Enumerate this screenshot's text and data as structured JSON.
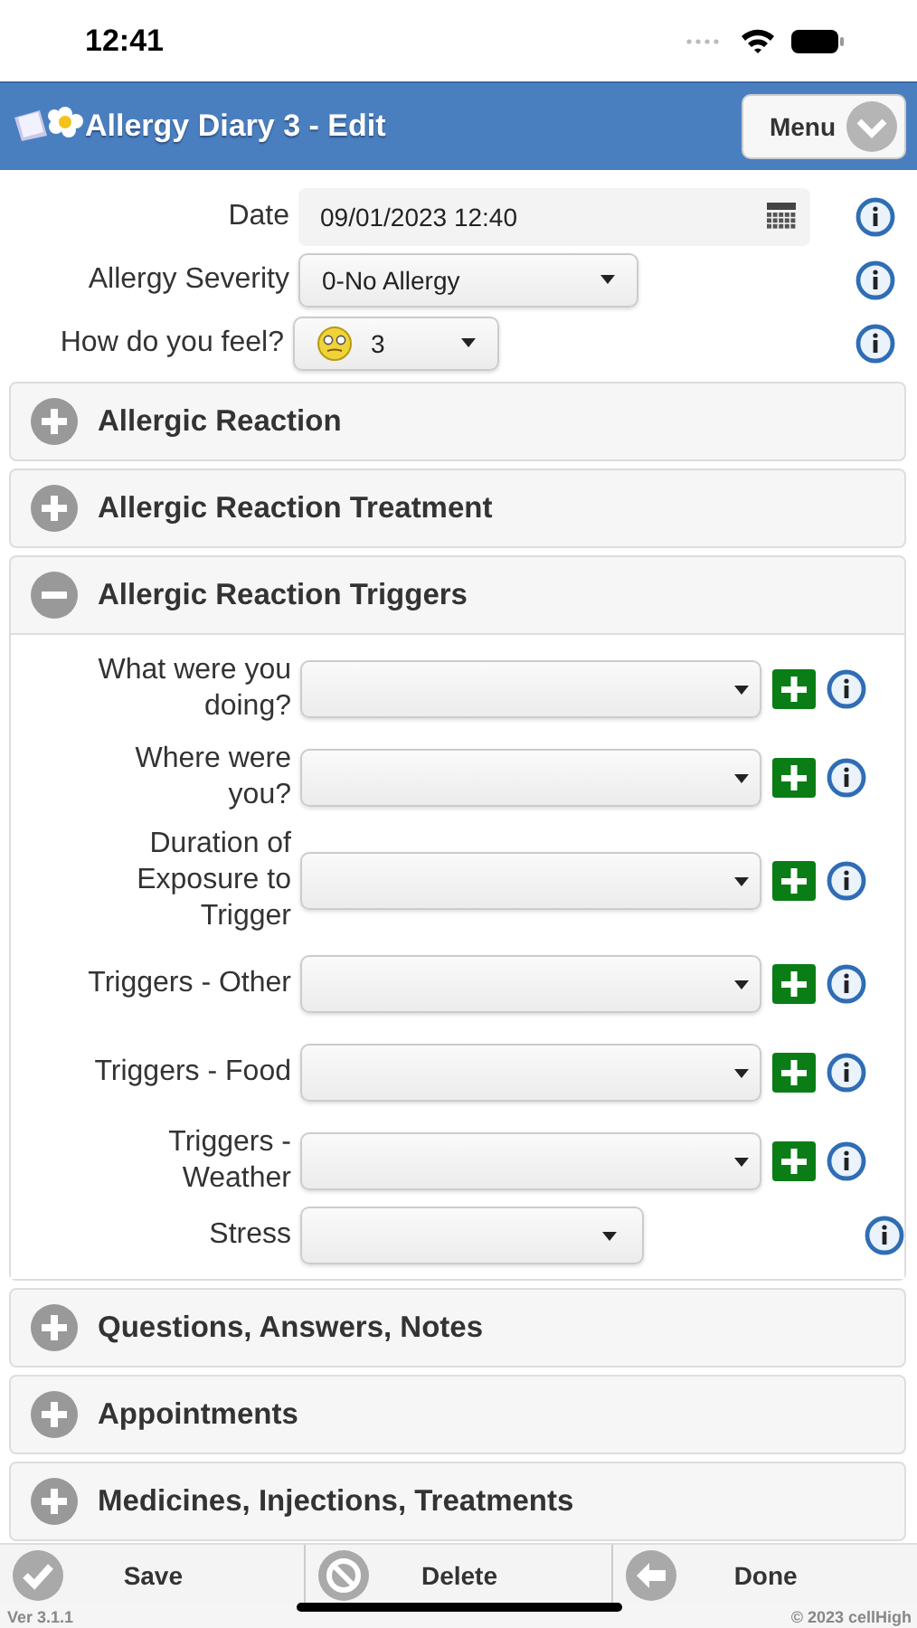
{
  "status_bar": {
    "time": "12:41"
  },
  "header": {
    "title": "Allergy Diary 3 - Edit",
    "menu_button": "Menu"
  },
  "top_fields": [
    {
      "label": "Date",
      "value": "09/01/2023 12:40",
      "kind": "date"
    },
    {
      "label": "Allergy Severity",
      "value": "0-No Allergy",
      "kind": "select"
    },
    {
      "label": "How do you feel?",
      "value": "3",
      "kind": "mood"
    }
  ],
  "sections": [
    {
      "title": "Allergic Reaction",
      "expanded": false
    },
    {
      "title": "Allergic Reaction Treatment",
      "expanded": false
    },
    {
      "title": "Allergic Reaction Triggers",
      "expanded": true,
      "fields": [
        {
          "label": "What were you doing?",
          "kind": "add"
        },
        {
          "label": "Where were you?",
          "kind": "add"
        },
        {
          "label": "Duration of Exposure to Trigger",
          "kind": "add"
        },
        {
          "label": "Triggers - Other",
          "kind": "add"
        },
        {
          "label": "Triggers - Food",
          "kind": "add"
        },
        {
          "label": "Triggers - Weather",
          "kind": "add"
        },
        {
          "label": "Stress",
          "kind": "plain"
        }
      ]
    },
    {
      "title": "Questions, Answers, Notes",
      "expanded": false
    },
    {
      "title": "Appointments",
      "expanded": false
    },
    {
      "title": "Medicines, Injections, Treatments",
      "expanded": false
    }
  ],
  "footer": {
    "buttons": [
      {
        "label": "Save",
        "kind": "check"
      },
      {
        "label": "Delete",
        "kind": "block"
      },
      {
        "label": "Done",
        "kind": "back"
      }
    ],
    "version": "Ver 3.1.1",
    "copyright": "© 2023 cellHigh"
  }
}
